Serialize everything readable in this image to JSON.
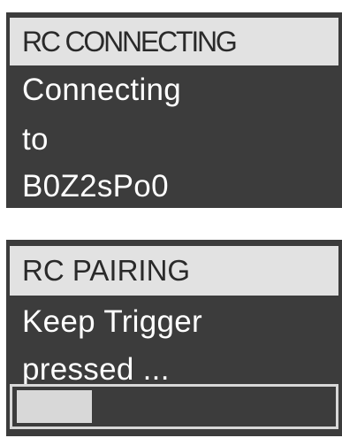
{
  "connecting_screen": {
    "header": "RC CONNECTING",
    "lines": [
      "Connecting",
      "to",
      "B0Z2sPo0"
    ]
  },
  "pairing_screen": {
    "header": "RC PAIRING",
    "lines": [
      "Keep Trigger",
      "pressed ..."
    ],
    "progress": 0.24
  },
  "colors": {
    "screen_background": "#3c3c3c",
    "header_background": "#e2e2e2",
    "header_text": "#2a2a2a",
    "body_text": "#ffffff",
    "progress": "#d8d8d8"
  }
}
